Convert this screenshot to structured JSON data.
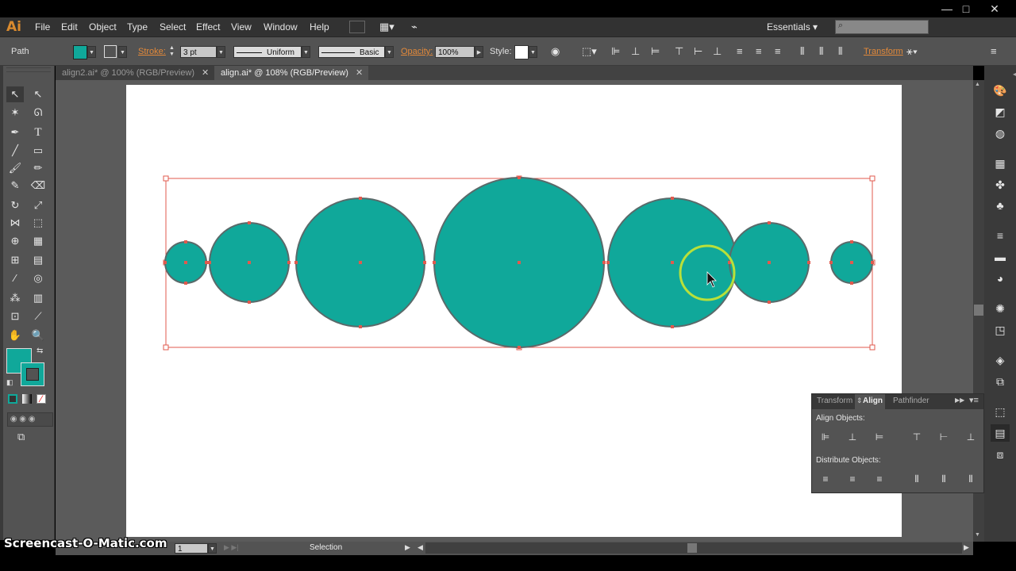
{
  "app": {
    "logo": "Ai",
    "workspace": "Essentials",
    "workspace_caret": "▾",
    "search_placeholder": ""
  },
  "menu": [
    "File",
    "Edit",
    "Object",
    "Type",
    "Select",
    "Effect",
    "View",
    "Window",
    "Help"
  ],
  "window_controls": [
    "—",
    "□",
    "✕"
  ],
  "control_bar": {
    "selection_type": "Path",
    "fill_color": "#10a89a",
    "stroke_label": "Stroke:",
    "stroke_value": "3 pt",
    "stroke_profile": "Uniform",
    "brush": "Basic",
    "opacity_label": "Opacity:",
    "opacity_value": "100%",
    "style_label": "Style:",
    "transform_label": "Transform"
  },
  "tabs": [
    {
      "label": "align2.ai* @ 100% (RGB/Preview)",
      "close": "✕",
      "active": false
    },
    {
      "label": "align.ai* @ 108% (RGB/Preview)",
      "close": "✕",
      "active": true
    }
  ],
  "tools": [
    "selection-tool",
    "direct-selection-tool",
    "magic-wand-tool",
    "lasso-tool",
    "pen-tool",
    "type-tool",
    "line-tool",
    "rectangle-tool",
    "paintbrush-tool",
    "pencil-tool",
    "blob-brush-tool",
    "eraser-tool",
    "rotate-tool",
    "scale-tool",
    "width-tool",
    "free-transform-tool",
    "shape-builder-tool",
    "perspective-grid-tool",
    "mesh-tool",
    "gradient-tool",
    "eyedropper-tool",
    "blend-tool",
    "symbol-sprayer-tool",
    "column-graph-tool",
    "artboard-tool",
    "slice-tool",
    "hand-tool",
    "zoom-tool"
  ],
  "colors": {
    "fill": "#10a89a",
    "stroke_inner": "#10a89a",
    "selection": "#e05a4e",
    "circle_stroke": "#5a6a6a",
    "cursor_ring": "#b9e03a"
  },
  "canvas": {
    "circles": [
      {
        "name": "circle-1"
      },
      {
        "name": "circle-2"
      },
      {
        "name": "circle-3"
      },
      {
        "name": "circle-4"
      },
      {
        "name": "circle-5"
      },
      {
        "name": "circle-6"
      },
      {
        "name": "circle-7"
      }
    ]
  },
  "align_panel": {
    "tabs": [
      "Transform",
      "Align",
      "Pathfinder"
    ],
    "active_tab": "Align",
    "align_objects_label": "Align Objects:",
    "distribute_objects_label": "Distribute Objects:",
    "align_buttons": [
      "horizontal-align-left",
      "horizontal-align-center",
      "horizontal-align-right",
      "vertical-align-top",
      "vertical-align-center",
      "vertical-align-bottom"
    ],
    "distribute_buttons": [
      "vertical-distribute-top",
      "vertical-distribute-center",
      "vertical-distribute-bottom",
      "horizontal-distribute-left",
      "horizontal-distribute-center",
      "horizontal-distribute-right"
    ]
  },
  "status": {
    "artboard_number": "1",
    "tool_status": "Selection"
  },
  "watermark": "Screencast-O-Matic.com"
}
